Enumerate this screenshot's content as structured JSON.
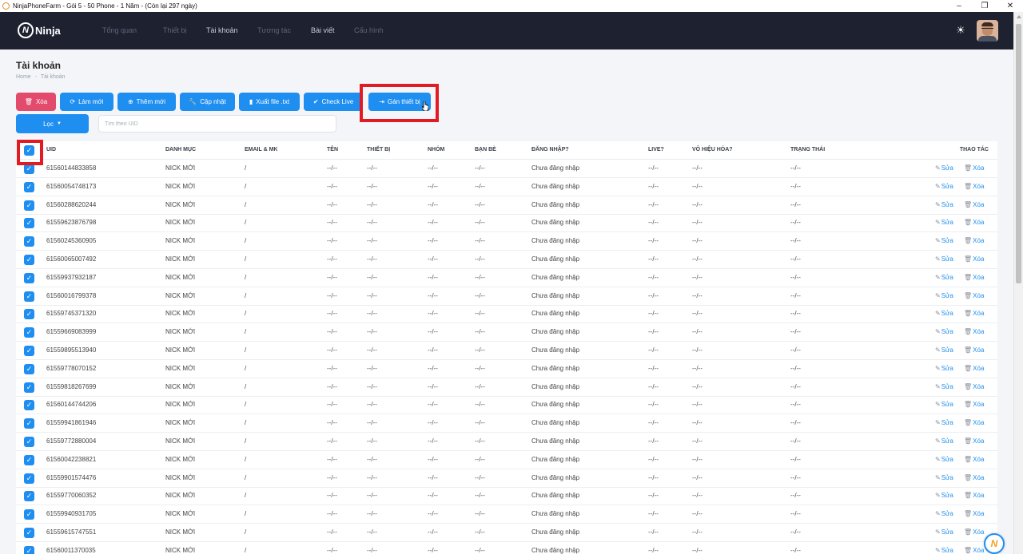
{
  "window": {
    "title": "NinjaPhoneFarm - Gói 5 - 50 Phone - 1 Năm - (Còn lại 297 ngày)",
    "minimize": "–",
    "maximize": "❐",
    "close": "✕"
  },
  "nav": {
    "logo": "Ninja",
    "items": [
      "Tổng quan",
      "Thiết bị",
      "Tài khoản",
      "Tương tác",
      "Bài viết",
      "Cấu hình"
    ],
    "active": "Tài khoản"
  },
  "page": {
    "title": "Tài khoản",
    "breadcrumb_home": "Home",
    "breadcrumb_sep": "-",
    "breadcrumb_current": "Tài khoản"
  },
  "toolbar": {
    "delete": "Xóa",
    "refresh": "Làm mới",
    "add": "Thêm mới",
    "update": "Cập nhật",
    "export": "Xuất file .txt",
    "check_live": "Check Live",
    "assign_device": "Gán thiết bị",
    "filter": "Lọc",
    "search_placeholder": "Tìm theo UID"
  },
  "table": {
    "headers": {
      "uid": "UID",
      "category": "DANH MỤC",
      "email": "EMAIL & MK",
      "name": "TÊN",
      "device": "THIẾT BỊ",
      "group": "NHÓM",
      "friends": "BẠN BÈ",
      "login": "ĐĂNG NHẬP?",
      "live": "LIVE?",
      "disabled": "VÔ HIỆU HÓA?",
      "status": "TRẠNG THÁI",
      "actions": "THAO TÁC"
    },
    "edit_label": "Sửa",
    "delete_label": "Xóa",
    "rows": [
      {
        "uid": "61560144833858",
        "category": "NICK MỚI",
        "email": "/",
        "name": "--/--",
        "device": "--/--",
        "group": "--/--",
        "friends": "--/--",
        "login": "Chưa đăng nhập",
        "live": "--/--",
        "disabled": "--/--",
        "status": "--/--"
      },
      {
        "uid": "61560054748173",
        "category": "NICK MỚI",
        "email": "/",
        "name": "--/--",
        "device": "--/--",
        "group": "--/--",
        "friends": "--/--",
        "login": "Chưa đăng nhập",
        "live": "--/--",
        "disabled": "--/--",
        "status": "--/--"
      },
      {
        "uid": "61560288620244",
        "category": "NICK MỚI",
        "email": "/",
        "name": "--/--",
        "device": "--/--",
        "group": "--/--",
        "friends": "--/--",
        "login": "Chưa đăng nhập",
        "live": "--/--",
        "disabled": "--/--",
        "status": "--/--"
      },
      {
        "uid": "61559623876798",
        "category": "NICK MỚI",
        "email": "/",
        "name": "--/--",
        "device": "--/--",
        "group": "--/--",
        "friends": "--/--",
        "login": "Chưa đăng nhập",
        "live": "--/--",
        "disabled": "--/--",
        "status": "--/--"
      },
      {
        "uid": "61560245360905",
        "category": "NICK MỚI",
        "email": "/",
        "name": "--/--",
        "device": "--/--",
        "group": "--/--",
        "friends": "--/--",
        "login": "Chưa đăng nhập",
        "live": "--/--",
        "disabled": "--/--",
        "status": "--/--"
      },
      {
        "uid": "61560065007492",
        "category": "NICK MỚI",
        "email": "/",
        "name": "--/--",
        "device": "--/--",
        "group": "--/--",
        "friends": "--/--",
        "login": "Chưa đăng nhập",
        "live": "--/--",
        "disabled": "--/--",
        "status": "--/--"
      },
      {
        "uid": "61559937932187",
        "category": "NICK MỚI",
        "email": "/",
        "name": "--/--",
        "device": "--/--",
        "group": "--/--",
        "friends": "--/--",
        "login": "Chưa đăng nhập",
        "live": "--/--",
        "disabled": "--/--",
        "status": "--/--"
      },
      {
        "uid": "61560016799378",
        "category": "NICK MỚI",
        "email": "/",
        "name": "--/--",
        "device": "--/--",
        "group": "--/--",
        "friends": "--/--",
        "login": "Chưa đăng nhập",
        "live": "--/--",
        "disabled": "--/--",
        "status": "--/--"
      },
      {
        "uid": "61559745371320",
        "category": "NICK MỚI",
        "email": "/",
        "name": "--/--",
        "device": "--/--",
        "group": "--/--",
        "friends": "--/--",
        "login": "Chưa đăng nhập",
        "live": "--/--",
        "disabled": "--/--",
        "status": "--/--"
      },
      {
        "uid": "61559669083999",
        "category": "NICK MỚI",
        "email": "/",
        "name": "--/--",
        "device": "--/--",
        "group": "--/--",
        "friends": "--/--",
        "login": "Chưa đăng nhập",
        "live": "--/--",
        "disabled": "--/--",
        "status": "--/--"
      },
      {
        "uid": "61559895513940",
        "category": "NICK MỚI",
        "email": "/",
        "name": "--/--",
        "device": "--/--",
        "group": "--/--",
        "friends": "--/--",
        "login": "Chưa đăng nhập",
        "live": "--/--",
        "disabled": "--/--",
        "status": "--/--"
      },
      {
        "uid": "61559778070152",
        "category": "NICK MỚI",
        "email": "/",
        "name": "--/--",
        "device": "--/--",
        "group": "--/--",
        "friends": "--/--",
        "login": "Chưa đăng nhập",
        "live": "--/--",
        "disabled": "--/--",
        "status": "--/--"
      },
      {
        "uid": "61559818267699",
        "category": "NICK MỚI",
        "email": "/",
        "name": "--/--",
        "device": "--/--",
        "group": "--/--",
        "friends": "--/--",
        "login": "Chưa đăng nhập",
        "live": "--/--",
        "disabled": "--/--",
        "status": "--/--"
      },
      {
        "uid": "61560144744206",
        "category": "NICK MỚI",
        "email": "/",
        "name": "--/--",
        "device": "--/--",
        "group": "--/--",
        "friends": "--/--",
        "login": "Chưa đăng nhập",
        "live": "--/--",
        "disabled": "--/--",
        "status": "--/--"
      },
      {
        "uid": "61559941861946",
        "category": "NICK MỚI",
        "email": "/",
        "name": "--/--",
        "device": "--/--",
        "group": "--/--",
        "friends": "--/--",
        "login": "Chưa đăng nhập",
        "live": "--/--",
        "disabled": "--/--",
        "status": "--/--"
      },
      {
        "uid": "61559772880004",
        "category": "NICK MỚI",
        "email": "/",
        "name": "--/--",
        "device": "--/--",
        "group": "--/--",
        "friends": "--/--",
        "login": "Chưa đăng nhập",
        "live": "--/--",
        "disabled": "--/--",
        "status": "--/--"
      },
      {
        "uid": "61560042238821",
        "category": "NICK MỚI",
        "email": "/",
        "name": "--/--",
        "device": "--/--",
        "group": "--/--",
        "friends": "--/--",
        "login": "Chưa đăng nhập",
        "live": "--/--",
        "disabled": "--/--",
        "status": "--/--"
      },
      {
        "uid": "61559901574476",
        "category": "NICK MỚI",
        "email": "/",
        "name": "--/--",
        "device": "--/--",
        "group": "--/--",
        "friends": "--/--",
        "login": "Chưa đăng nhập",
        "live": "--/--",
        "disabled": "--/--",
        "status": "--/--"
      },
      {
        "uid": "61559770060352",
        "category": "NICK MỚI",
        "email": "/",
        "name": "--/--",
        "device": "--/--",
        "group": "--/--",
        "friends": "--/--",
        "login": "Chưa đăng nhập",
        "live": "--/--",
        "disabled": "--/--",
        "status": "--/--"
      },
      {
        "uid": "61559940931705",
        "category": "NICK MỚI",
        "email": "/",
        "name": "--/--",
        "device": "--/--",
        "group": "--/--",
        "friends": "--/--",
        "login": "Chưa đăng nhập",
        "live": "--/--",
        "disabled": "--/--",
        "status": "--/--"
      },
      {
        "uid": "61559615747551",
        "category": "NICK MỚI",
        "email": "/",
        "name": "--/--",
        "device": "--/--",
        "group": "--/--",
        "friends": "--/--",
        "login": "Chưa đăng nhập",
        "live": "--/--",
        "disabled": "--/--",
        "status": "--/--"
      },
      {
        "uid": "61560011370035",
        "category": "NICK MỚI",
        "email": "/",
        "name": "--/--",
        "device": "--/--",
        "group": "--/--",
        "friends": "--/--",
        "login": "Chưa đăng nhập",
        "live": "--/--",
        "disabled": "--/--",
        "status": "--/--"
      }
    ]
  },
  "colors": {
    "nav_bg": "#1e2130",
    "primary": "#1f8ef1",
    "danger": "#e24b6c",
    "highlight": "#e01b24"
  }
}
